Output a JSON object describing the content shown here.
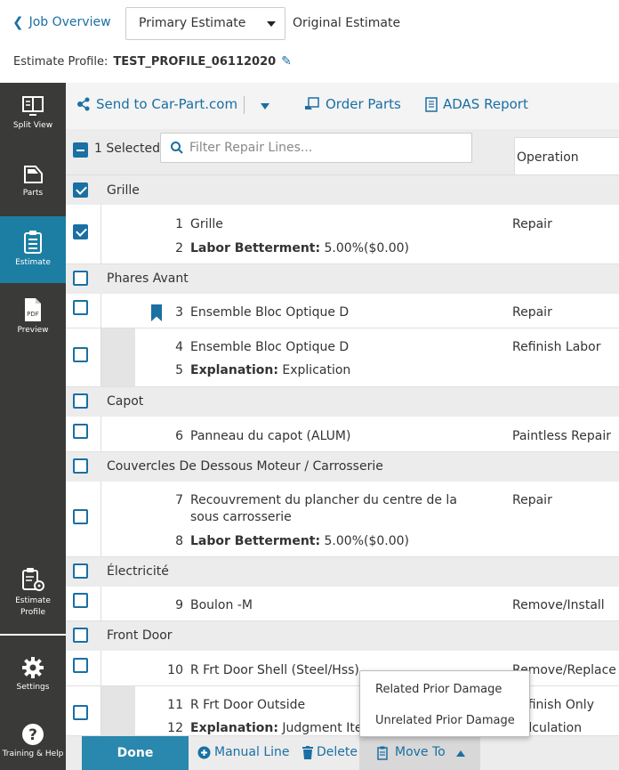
{
  "header": {
    "back_label": "Job Overview",
    "estimate_select": "Primary Estimate",
    "original_estimate": "Original Estimate",
    "profile_label": "Estimate Profile:",
    "profile_value": "TEST_PROFILE_06112020"
  },
  "sidebar": {
    "items": [
      {
        "label": "Split View",
        "icon": "split-view-icon"
      },
      {
        "label": "Parts",
        "icon": "car-door-icon"
      },
      {
        "label": "Estimate",
        "icon": "clipboard-icon",
        "active": true
      },
      {
        "label": "Preview",
        "icon": "pdf-icon",
        "badge": "PDF"
      },
      {
        "label": "Estimate Profile",
        "icon": "clipboard-gear-icon"
      },
      {
        "label": "Settings",
        "icon": "gear-icon"
      },
      {
        "label": "Training & Help",
        "icon": "help-icon"
      }
    ]
  },
  "toolbar": {
    "send_label": "Send to Car-Part.com",
    "order_label": "Order Parts",
    "adas_label": "ADAS Report"
  },
  "filter": {
    "selected_text": "1 Selected",
    "placeholder": "Filter Repair Lines...",
    "operation_header": "Operation"
  },
  "groups": [
    {
      "name": "Grille",
      "checked": true
    },
    {
      "name": "Phares Avant",
      "checked": false
    },
    {
      "name": "Capot",
      "checked": false
    },
    {
      "name": "Couvercles De Dessous Moteur / Carrosserie",
      "checked": false
    },
    {
      "name": "Électricité",
      "checked": false
    },
    {
      "name": "Front Door",
      "checked": false
    }
  ],
  "lines": [
    {
      "n1": "1",
      "desc1": "Grille",
      "n2": "2",
      "label2": "Labor Betterment:",
      "desc2": " 5.00%($0.00)",
      "op": "Repair",
      "checked": true
    },
    {
      "n1": "3",
      "desc1": "Ensemble Bloc Optique D",
      "op": "Repair",
      "bookmarked": true
    },
    {
      "n1": "4",
      "desc1": "Ensemble Bloc Optique D",
      "n2": "5",
      "label2": "Explanation:",
      "desc2": " Explication",
      "op": "Refinish Labor"
    },
    {
      "n1": "6",
      "desc1": "Panneau du capot (ALUM)",
      "op": "Paintless Repair"
    },
    {
      "n1": "7",
      "desc1": "Recouvrement du plancher du centre de la sous carrosserie",
      "n2": "8",
      "label2": "Labor Betterment:",
      "desc2": " 5.00%($0.00)",
      "op": "Repair"
    },
    {
      "n1": "9",
      "desc1": "Boulon -M",
      "op": "Remove/Install"
    },
    {
      "n1": "10",
      "desc1": "R Frt Door Shell (Steel/Hss)",
      "op": "Remove/Replace"
    },
    {
      "n1": "11",
      "desc1": "R Frt Door Outside",
      "n2": "12",
      "label2": "Explanation:",
      "desc2": " Judgment Item;",
      "op": "Refinish Only",
      "op2": "Calculation"
    }
  ],
  "bottom": {
    "done": "Done",
    "manual_line": "Manual Line",
    "delete": "Delete",
    "move_to": "Move To"
  },
  "popup": {
    "items": [
      "Related Prior Damage",
      "Unrelated Prior Damage"
    ]
  },
  "colors": {
    "accent": "#1a6fa3",
    "sidebar_bg": "#3a3a38",
    "sidebar_active": "#1c7ea3",
    "done_button": "#2a87ad"
  }
}
